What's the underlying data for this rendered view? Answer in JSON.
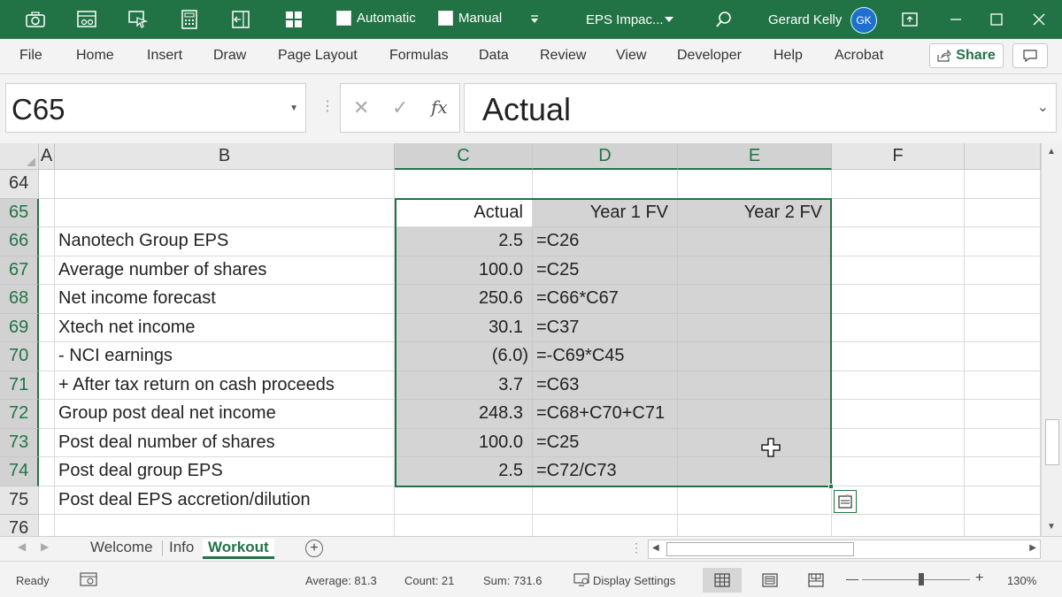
{
  "titlebar": {
    "automatic_label": "Automatic",
    "manual_label": "Manual",
    "doc_title": "EPS Impac...",
    "user_name": "Gerard Kelly",
    "user_initials": "GK"
  },
  "ribbon": {
    "tabs": [
      "File",
      "Home",
      "Insert",
      "Draw",
      "Page Layout",
      "Formulas",
      "Data",
      "Review",
      "View",
      "Developer",
      "Help",
      "Acrobat"
    ],
    "share_label": "Share"
  },
  "formula_bar": {
    "name_box": "C65",
    "fx_label": "fx",
    "content": "Actual"
  },
  "columns": [
    "A",
    "B",
    "C",
    "D",
    "E",
    "F"
  ],
  "rows": [
    {
      "num": "64",
      "b": "",
      "c": "",
      "d": "",
      "e": ""
    },
    {
      "num": "65",
      "b": "",
      "c": "Actual",
      "d": "Year 1 FV",
      "e": "Year 2 FV"
    },
    {
      "num": "66",
      "b": "Nanotech Group EPS",
      "c": "2.5",
      "d": "=C26",
      "e": ""
    },
    {
      "num": "67",
      "b": "Average number of shares",
      "c": "100.0",
      "d": "=C25",
      "e": ""
    },
    {
      "num": "68",
      "b": "Net income forecast",
      "c": "250.6",
      "d": "=C66*C67",
      "e": ""
    },
    {
      "num": "69",
      "b": "Xtech net income",
      "c": "30.1",
      "d": "=C37",
      "e": ""
    },
    {
      "num": "70",
      "b": "- NCI earnings",
      "c": "(6.0)",
      "d": "=-C69*C45",
      "e": ""
    },
    {
      "num": "71",
      "b": "+ After tax return on cash proceeds",
      "c": "3.7",
      "d": "=C63",
      "e": ""
    },
    {
      "num": "72",
      "b": "Group post deal net income",
      "c": "248.3",
      "d": "=C68+C70+C71",
      "e": ""
    },
    {
      "num": "73",
      "b": "Post deal number of shares",
      "c": "100.0",
      "d": "=C25",
      "e": ""
    },
    {
      "num": "74",
      "b": "Post deal group EPS",
      "c": "2.5",
      "d": "=C72/C73",
      "e": ""
    },
    {
      "num": "75",
      "b": "Post deal EPS accretion/dilution",
      "c": "",
      "d": "",
      "e": ""
    },
    {
      "num": "76",
      "b": "",
      "c": "",
      "d": "",
      "e": ""
    }
  ],
  "sheets": {
    "tabs": [
      "Welcome",
      "Info",
      "Workout"
    ],
    "active": "Workout"
  },
  "status": {
    "ready": "Ready",
    "average": "Average: 81.3",
    "count": "Count: 21",
    "sum": "Sum: 731.6",
    "display_settings": "Display Settings",
    "zoom": "130%",
    "minus": "—",
    "plus": "+"
  }
}
